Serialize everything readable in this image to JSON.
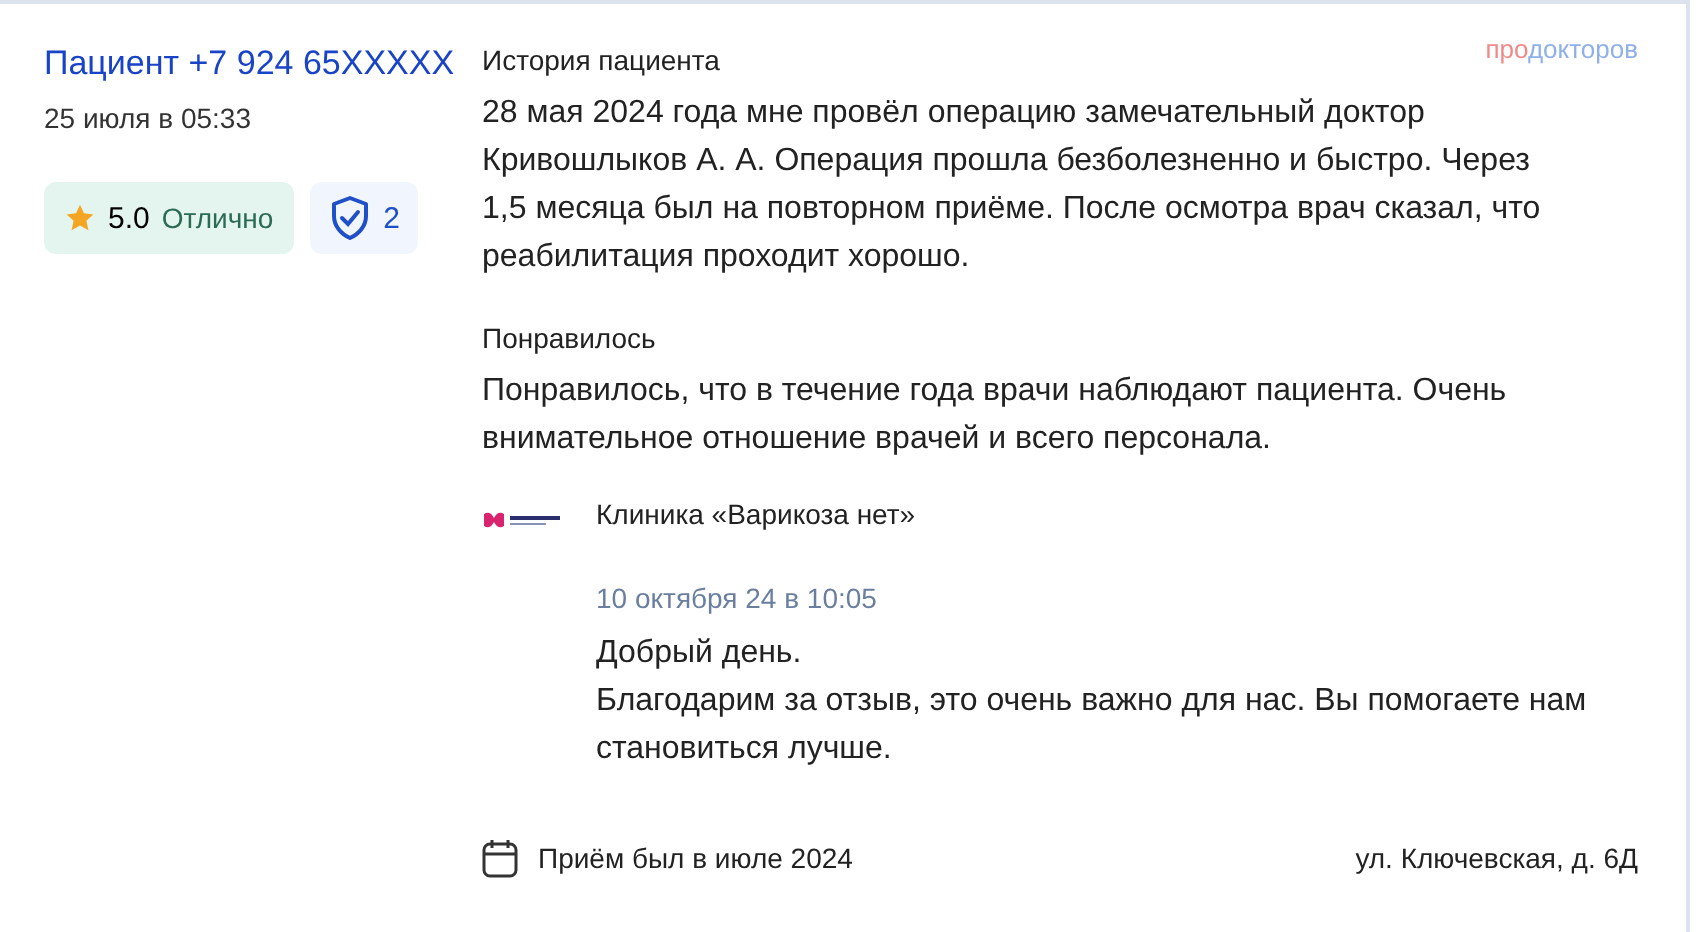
{
  "author": {
    "name": "Пациент +7 924 65XXXXX",
    "date": "25 июля в 05:33"
  },
  "rating": {
    "score": "5.0",
    "label": "Отлично"
  },
  "verifications": {
    "count": "2"
  },
  "logo": {
    "accent": "про",
    "rest": "докторов"
  },
  "sections": [
    {
      "heading": "История пациента",
      "text": "28 мая 2024 года мне провёл операцию замечательный доктор Кривошлыков А. А. Операция прошла безболезненно и быстро. Через 1,5 месяца был на повторном приёме. После осмотра врач сказал, что реабилитация проходит хорошо."
    },
    {
      "heading": "Понравилось",
      "text": "Понравилось, что в течение года врачи наблюдают пациента. Очень внимательное отношение врачей и всего персонала."
    }
  ],
  "reply": {
    "clinic": "Клиника «Варикоза нет»",
    "date": "10 октября 24 в 10:05",
    "lines": [
      "Добрый день.",
      "Благодарим за отзыв, это очень важно для нас. Вы помогаете нам становиться лучше."
    ]
  },
  "footer": {
    "visit": "Приём был в июле 2024",
    "address": "ул. Ключевская, д. 6Д"
  }
}
